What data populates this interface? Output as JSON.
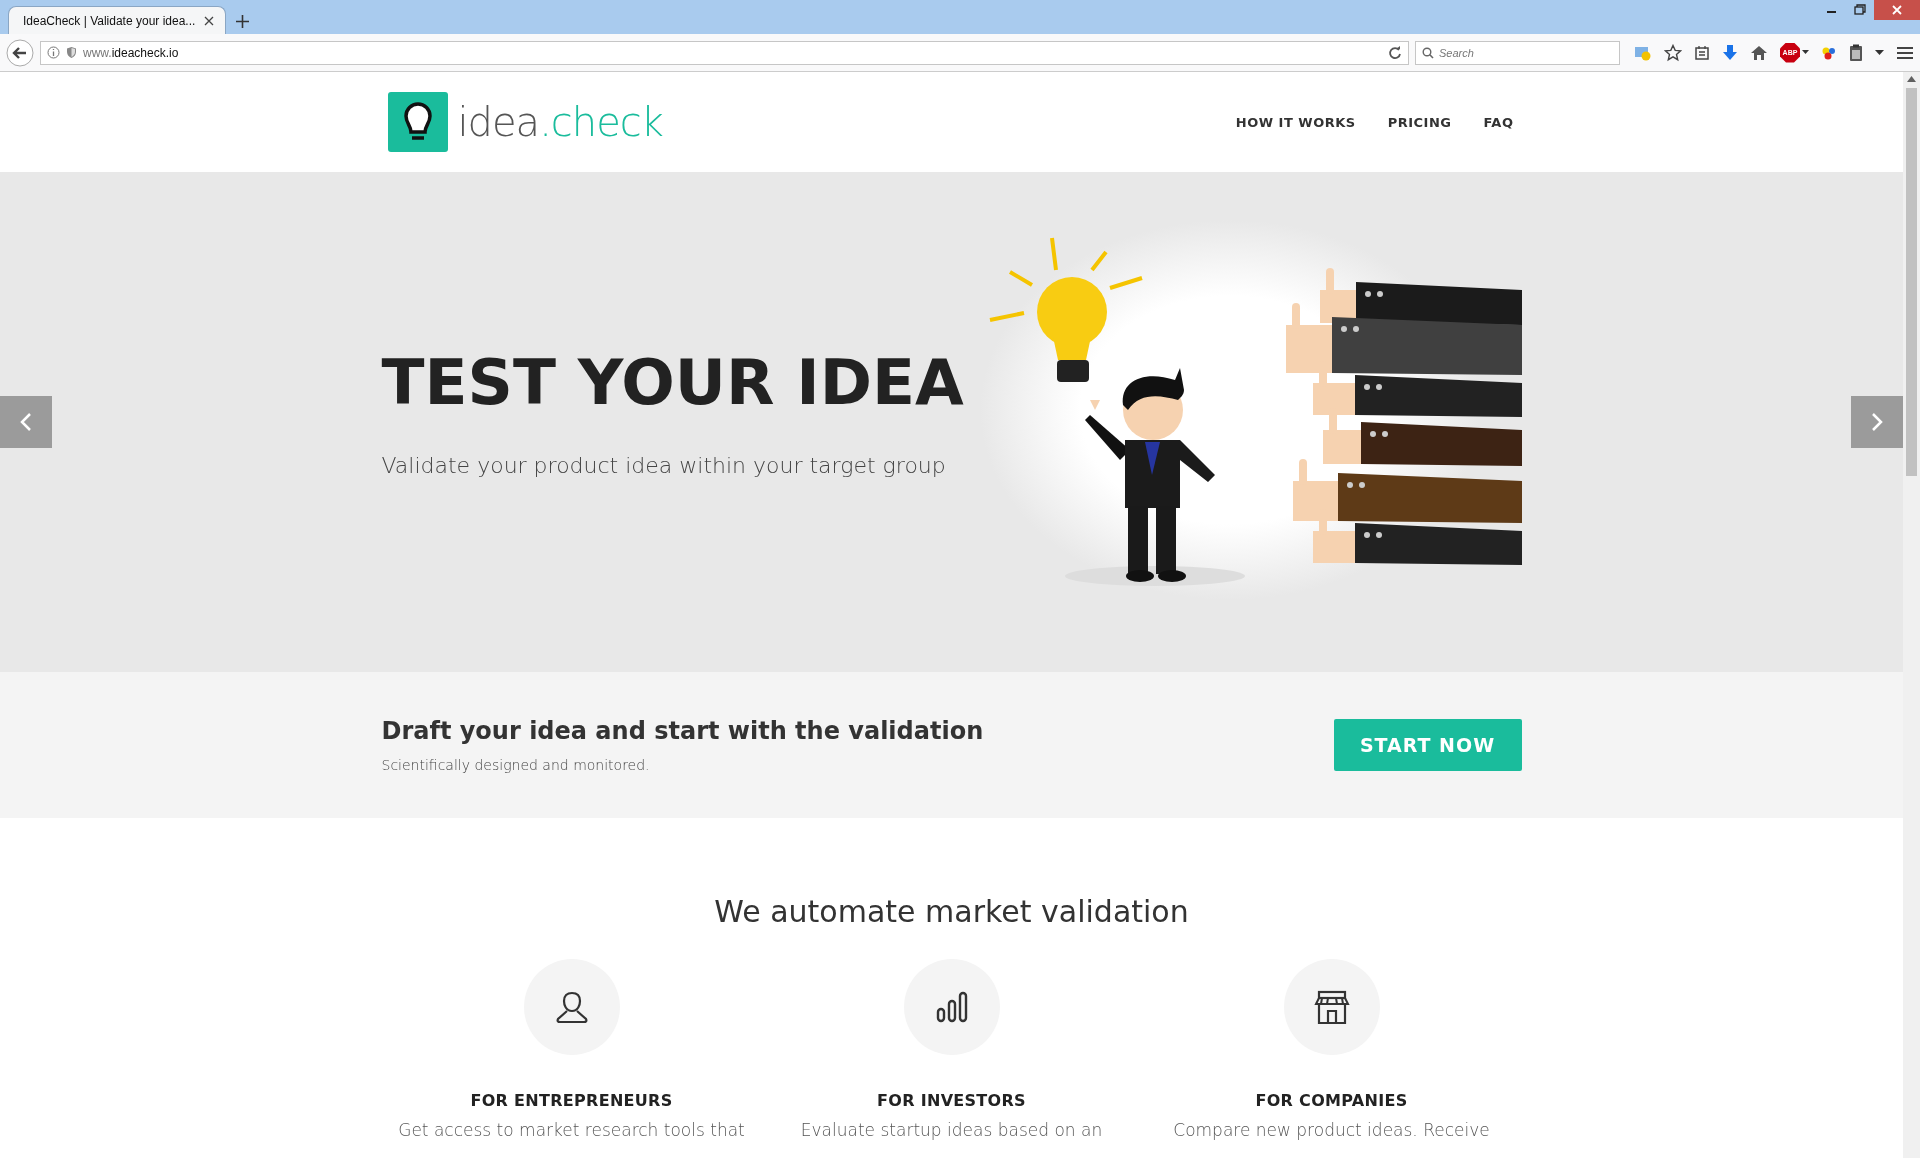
{
  "browser": {
    "tab_title": "IdeaCheck | Validate your idea...",
    "url_prefix": "www.",
    "url_domain": "ideacheck.io",
    "search_placeholder": "Search",
    "adblock_label": "ABP"
  },
  "header": {
    "logo_word": "idea",
    "logo_accent": ".check",
    "nav": [
      {
        "label": "HOW IT WORKS"
      },
      {
        "label": "PRICING"
      },
      {
        "label": "FAQ"
      }
    ]
  },
  "hero": {
    "title": "TEST YOUR IDEA",
    "subtitle": "Validate your product idea within your target group"
  },
  "cta": {
    "heading": "Draft your idea and start with the validation",
    "subtext": "Scientifically designed and monitored.",
    "button": "START NOW"
  },
  "features": {
    "heading": "We automate market validation",
    "items": [
      {
        "kind": "person",
        "title": "FOR ENTREPRENEURS",
        "text": "Get access to market research tools that"
      },
      {
        "kind": "chart",
        "title": "FOR INVESTORS",
        "text": "Evaluate startup ideas based on an"
      },
      {
        "kind": "store",
        "title": "FOR COMPANIES",
        "text": "Compare new product ideas. Receive"
      }
    ]
  }
}
